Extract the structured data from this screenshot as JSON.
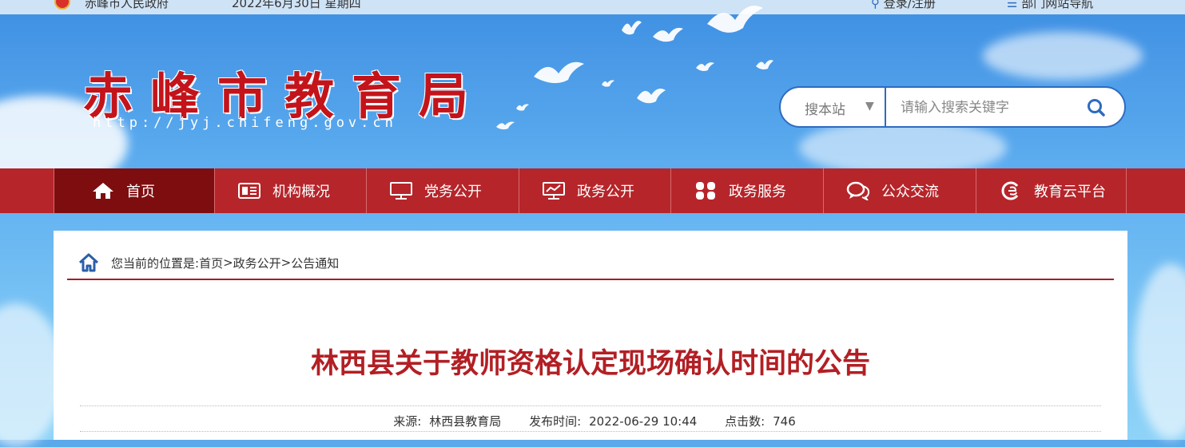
{
  "topbar": {
    "gov_link": "赤峰市人民政府",
    "date": "2022年6月30日 星期四",
    "login": "登录/注册",
    "nav_link": "部门网站导航"
  },
  "header": {
    "site_name": "赤峰市教育局",
    "url": "http://jyj.chifeng.gov.cn"
  },
  "search": {
    "scope": "搜本站",
    "placeholder": "请输入搜索关键字"
  },
  "nav": {
    "items": [
      {
        "label": "首页",
        "icon": "home-icon",
        "active": true
      },
      {
        "label": "机构概况",
        "icon": "newspaper-icon"
      },
      {
        "label": "党务公开",
        "icon": "monitor-icon"
      },
      {
        "label": "政务公开",
        "icon": "screen-chart-icon"
      },
      {
        "label": "政务服务",
        "icon": "grid-icon"
      },
      {
        "label": "公众交流",
        "icon": "chat-icon"
      },
      {
        "label": "教育云平台",
        "icon": "cloud-e-icon"
      }
    ]
  },
  "breadcrumb": {
    "prefix": "您当前的位置是:",
    "items": [
      "首页",
      "政务公开",
      "公告通知"
    ],
    "separator": ">"
  },
  "article": {
    "title": "林西县关于教师资格认定现场确认时间的公告",
    "source_label": "来源:",
    "source": "林西县教育局",
    "published_label": "发布时间:",
    "published": "2022-06-29 10:44",
    "clicks_label": "点击数:",
    "clicks": "746"
  },
  "colors": {
    "nav_bg": "#b6252a",
    "nav_active": "#7e0d10",
    "title_red": "#b21f24",
    "accent_blue": "#2e6bc1"
  }
}
